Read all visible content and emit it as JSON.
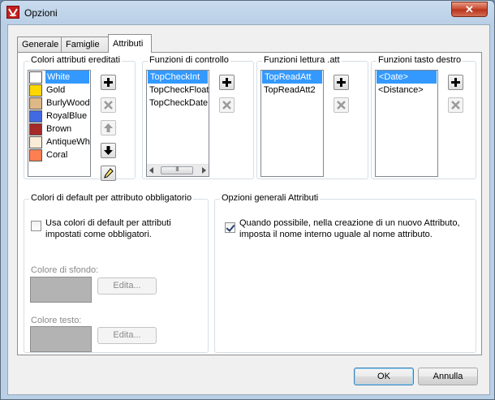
{
  "window": {
    "title": "Opzioni",
    "close_glyph": "✕"
  },
  "tabs": [
    {
      "label": "Generale",
      "active": false
    },
    {
      "label": "Famiglie",
      "active": false
    },
    {
      "label": "Attributi",
      "active": true
    }
  ],
  "inherited_colors": {
    "title": "Colori attributi ereditati",
    "items": [
      {
        "name": "White",
        "color": "#ffffff",
        "selected": true
      },
      {
        "name": "Gold",
        "color": "#ffd700"
      },
      {
        "name": "BurlyWood",
        "color": "#deb887"
      },
      {
        "name": "RoyalBlue",
        "color": "#4169e1"
      },
      {
        "name": "Brown",
        "color": "#a52a2a"
      },
      {
        "name": "AntiqueWhit",
        "color": "#faebd7"
      },
      {
        "name": "Coral",
        "color": "#ff7f50"
      }
    ]
  },
  "control_functions": {
    "title": "Funzioni di controllo",
    "items": [
      "TopCheckInt",
      "TopCheckFloat",
      "TopCheckDate"
    ],
    "scroll_thumb_glyph": "III"
  },
  "read_functions": {
    "title": "Funzioni lettura .att",
    "items": [
      "TopReadAtt",
      "TopReadAtt2"
    ]
  },
  "right_button_functions": {
    "title": "Funzioni tasto destro",
    "items": [
      "<Date>",
      "<Distance>"
    ]
  },
  "default_colors": {
    "title": "Colori di default per attributo obbligatorio",
    "checkbox_label_line1": "Usa colori di default per attributi",
    "checkbox_label_line2": "impostati come obbligatori.",
    "checkbox_checked": false,
    "background_label": "Colore di sfondo:",
    "text_label": "Colore testo:",
    "edit_button": "Edita...",
    "swatch_color": "#b3b3b3"
  },
  "general_options": {
    "title": "Opzioni generali Attributi",
    "checkbox_label_line1": "Quando possibile, nella creazione di un nuovo Attributo,",
    "checkbox_label_line2": "imposta il nome interno uguale al nome attributo.",
    "checkbox_checked": true
  },
  "footer": {
    "ok": "OK",
    "cancel": "Annulla"
  },
  "icons": {
    "add": "plus-icon",
    "remove": "x-icon",
    "up": "arrow-up-icon",
    "down": "arrow-down-icon",
    "edit": "pencil-icon"
  }
}
